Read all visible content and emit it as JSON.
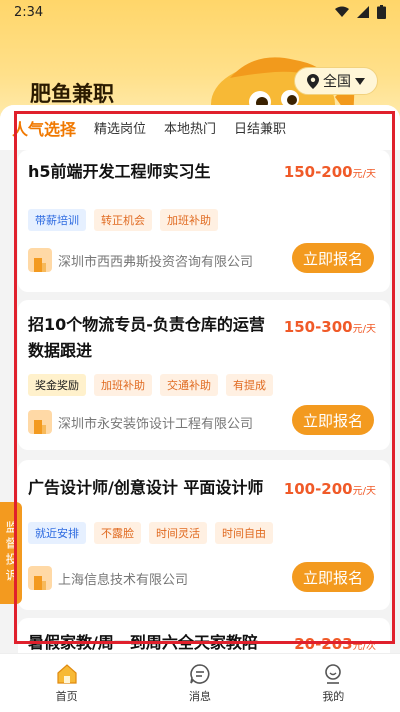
{
  "status": {
    "time": "2:34"
  },
  "header": {
    "app_name": "肥鱼兼职",
    "region": "全国"
  },
  "tabs": [
    {
      "label": "人气选择",
      "active": true
    },
    {
      "label": "精选岗位",
      "active": false
    },
    {
      "label": "本地热门",
      "active": false
    },
    {
      "label": "日结兼职",
      "active": false
    }
  ],
  "jobs": [
    {
      "title": "h5前端开发工程师实习生",
      "salary": "150-200",
      "unit": "元/天",
      "tags": [
        "带薪培训",
        "转正机会",
        "加班补助"
      ],
      "company": "深圳市西西弗斯投资咨询有限公司",
      "apply_label": "立即报名"
    },
    {
      "title": "招10个物流专员-负责仓库的运营数据跟进",
      "salary": "150-300",
      "unit": "元/天",
      "tags": [
        "奖金奖励",
        "加班补助",
        "交通补助",
        "有提成"
      ],
      "company": "深圳市永安装饰设计工程有限公司",
      "apply_label": "立即报名"
    },
    {
      "title": "广告设计师/创意设计 平面设计师",
      "salary": "100-200",
      "unit": "元/天",
      "tags": [
        "就近安排",
        "不露脸",
        "时间灵活",
        "时间自由"
      ],
      "company": "上海信息技术有限公司",
      "apply_label": "立即报名"
    },
    {
      "title": "暑假家教/周一到周六全天家教陪",
      "salary": "20-203",
      "unit": "元/次"
    }
  ],
  "supervise_label": "监督投诉",
  "nav": [
    {
      "label": "首页",
      "active": true
    },
    {
      "label": "消息",
      "active": false
    },
    {
      "label": "我的",
      "active": false
    }
  ],
  "colors": {
    "accent": "#f39a1f",
    "salary": "#f05a28",
    "highlight": "#e0202c"
  }
}
